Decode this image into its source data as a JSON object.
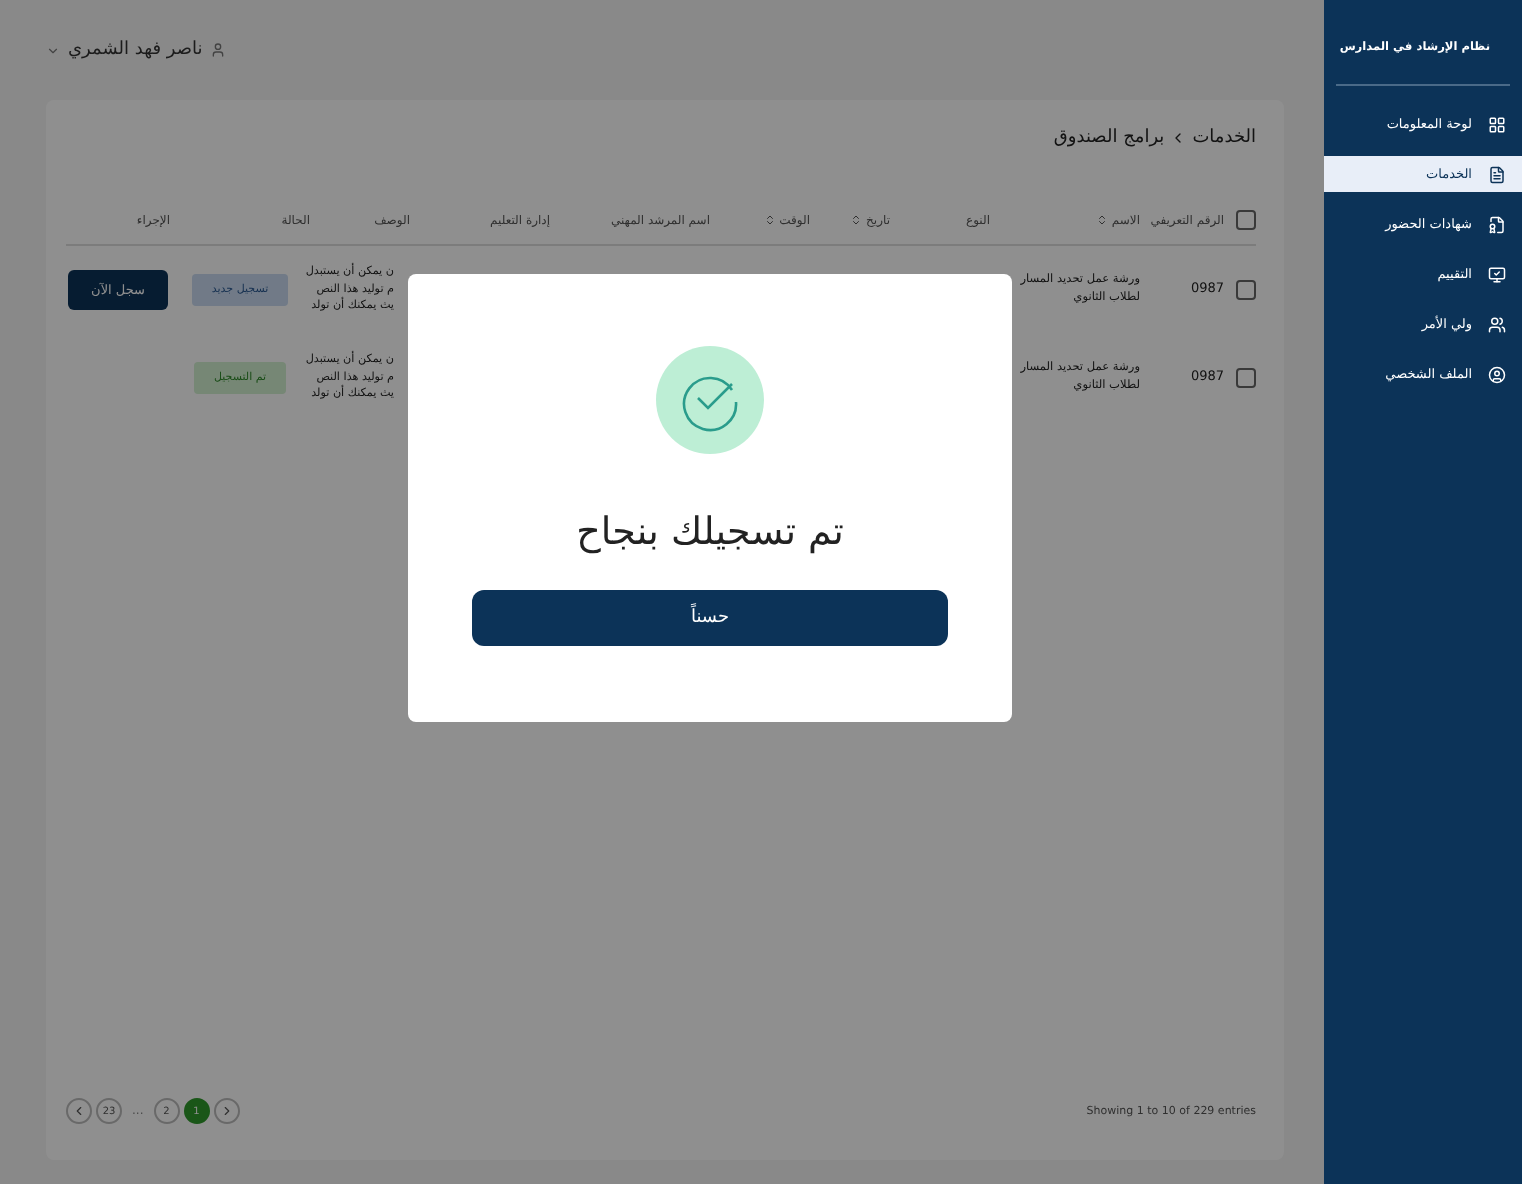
{
  "user": {
    "name": "ناصر فهد الشمري"
  },
  "sidebar": {
    "title": "نظام الإرشاد في المدارس",
    "items": [
      {
        "label": "لوحة المعلومات",
        "selected": false
      },
      {
        "label": "الخدمات",
        "selected": true
      },
      {
        "label": "شهادات الحضور",
        "selected": false
      },
      {
        "label": "التقييم",
        "selected": false
      },
      {
        "label": "ولي الأمر",
        "selected": false
      },
      {
        "label": "الملف الشخصي",
        "selected": false
      }
    ]
  },
  "breadcrumb": [
    "الخدمات",
    "برامج الصندوق"
  ],
  "table": {
    "select_all": false,
    "columns": [
      {
        "label": "الرقم التعريفي",
        "sortable": false
      },
      {
        "label": "الاسم",
        "sortable": true
      },
      {
        "label": "النوع",
        "sortable": false
      },
      {
        "label": "تاريخ",
        "sortable": true
      },
      {
        "label": "الوقت",
        "sortable": true
      },
      {
        "label": "اسم المرشد المهني",
        "sortable": false
      },
      {
        "label": "إدارة التعليم",
        "sortable": false
      },
      {
        "label": "الوصف",
        "sortable": false
      },
      {
        "label": "الحالة",
        "sortable": false
      },
      {
        "label": "الإجراء",
        "sortable": false
      }
    ],
    "rows": [
      {
        "checked": false,
        "id": "0987",
        "name": [
          "ورشة عمل تحديد المسار",
          "لطلاب الثانوي"
        ],
        "description": [
          "ن يمكن أن يستبدل",
          "م توليد هذا النص",
          "يث يمكنك أن تولد"
        ],
        "status": {
          "kind": "open",
          "label": "تسجيل جديد"
        },
        "action": "سجل الآن"
      },
      {
        "checked": false,
        "id": "0987",
        "name": [
          "ورشة عمل تحديد المسار",
          "لطلاب الثانوي"
        ],
        "description": [
          "ن يمكن أن يستبدل",
          "م توليد هذا النص",
          "يث يمكنك أن تولد"
        ],
        "status": {
          "kind": "done",
          "label": "تم التسجيل"
        }
      }
    ]
  },
  "footer": {
    "summary": "Showing 1 to 10 of 229 entries",
    "pages": [
      {
        "label": "1",
        "selected": true
      },
      {
        "label": "2",
        "selected": false
      }
    ],
    "ellipsis": "...",
    "last_page": {
      "label": "23",
      "selected": false
    }
  },
  "dialog": {
    "message": "تم تسجيلك بنجاح",
    "button": "حسناً"
  }
}
